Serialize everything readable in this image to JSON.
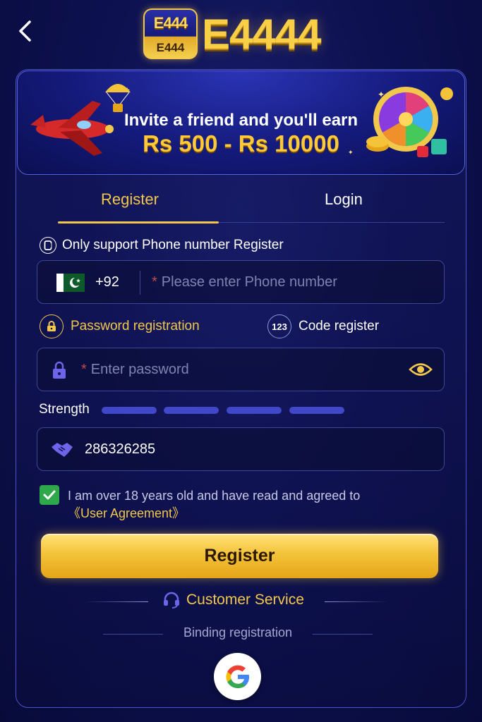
{
  "header": {
    "back_icon": "chevron-left-icon",
    "logo_badge_line1": "E444",
    "logo_badge_line2": "E444",
    "brand_title": "E4444"
  },
  "banner": {
    "line1": "Invite a friend and you'll earn",
    "line2": "Rs 500 - Rs 10000"
  },
  "tabs": [
    {
      "label": "Register",
      "active": true
    },
    {
      "label": "Login",
      "active": false
    }
  ],
  "phone_note": "Only support Phone number Register",
  "phone": {
    "flag": "pakistan-flag-icon",
    "country_code": "+92",
    "placeholder": "Please enter Phone number",
    "required_mark": "*"
  },
  "modes": {
    "password_label": "Password registration",
    "code_label": "Code register",
    "code_icon_text": "123",
    "active": "password"
  },
  "password": {
    "placeholder": "Enter password",
    "required_mark": "*"
  },
  "strength": {
    "label": "Strength",
    "segments": 4
  },
  "invite_code": {
    "value": "286326285",
    "icon": "handshake-icon"
  },
  "agreement": {
    "checked": true,
    "text": "I am over 18 years old and have read and agreed to",
    "link": "《User Agreement》"
  },
  "register_button": "Register",
  "customer_service": "Customer Service",
  "binding_label": "Binding registration",
  "social": [
    "google-icon"
  ],
  "colors": {
    "accent": "#f2c74c",
    "background": "#0d1150",
    "border": "#3d4596",
    "check": "#2ea84a",
    "strength_bar": "#4047c8"
  }
}
